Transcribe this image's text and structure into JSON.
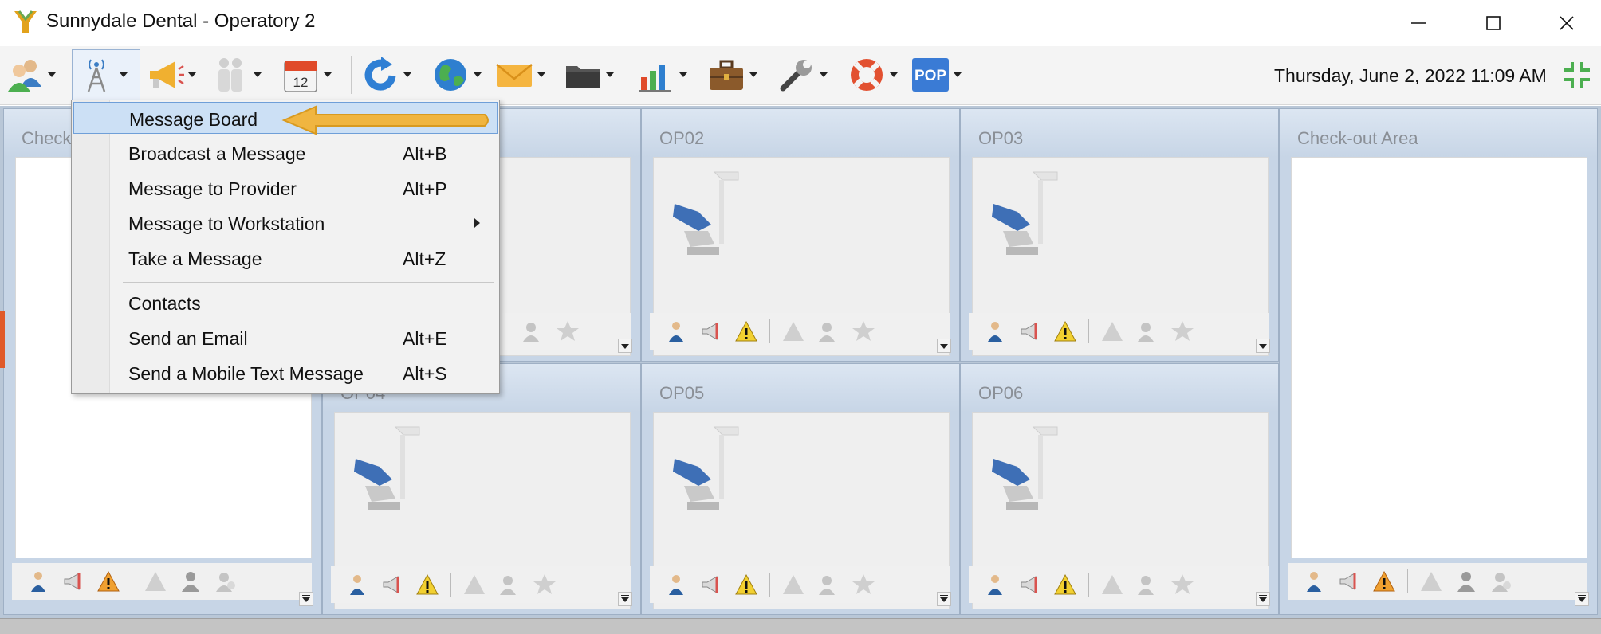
{
  "window": {
    "title": "Sunnydale Dental - Operatory 2",
    "controls": [
      "minimize",
      "maximize",
      "close"
    ]
  },
  "toolbar": {
    "items": [
      {
        "icon": "users-icon"
      },
      {
        "icon": "broadcast-tower-icon",
        "active": true
      },
      {
        "icon": "megaphone-icon"
      },
      {
        "icon": "staff-icon"
      },
      {
        "icon": "calendar-icon",
        "text": "12"
      },
      {
        "icon": "refresh-icon"
      },
      {
        "icon": "globe-icon"
      },
      {
        "icon": "mail-icon"
      },
      {
        "icon": "folder-icon"
      },
      {
        "icon": "bar-chart-icon"
      },
      {
        "icon": "briefcase-icon"
      },
      {
        "icon": "wrench-icon"
      },
      {
        "icon": "lifebuoy-icon"
      },
      {
        "icon": "pop-icon",
        "text": "POP"
      }
    ],
    "datetime": "Thursday, June 2, 2022 11:09 AM",
    "grid_icon": "collapse-grid-icon"
  },
  "menu": {
    "items": [
      {
        "label": "Message Board",
        "shortcut": "",
        "highlighted": true
      },
      {
        "label": "Broadcast a Message",
        "shortcut": "Alt+B"
      },
      {
        "label": "Message to Provider",
        "shortcut": "Alt+P"
      },
      {
        "label": "Message to Workstation",
        "shortcut": "",
        "submenu": true
      },
      {
        "label": "Take a Message",
        "shortcut": "Alt+Z"
      },
      {
        "label": "Contacts",
        "shortcut": ""
      },
      {
        "label": "Send an Email",
        "shortcut": "Alt+E"
      },
      {
        "label": "Send a Mobile Text Message",
        "shortcut": "Alt+S"
      }
    ]
  },
  "panes": {
    "checkin": {
      "title": "Check"
    },
    "op02": {
      "title": "OP02"
    },
    "op03": {
      "title": "OP03"
    },
    "op04": {
      "title": "OP04"
    },
    "op05": {
      "title": "OP05"
    },
    "op06": {
      "title": "OP06"
    },
    "checkout": {
      "title": "Check-out Area"
    }
  },
  "colors": {
    "accent": "#f0a830",
    "selection": "#cce0f5",
    "pane_bg": "#c7d5e6",
    "pop": "#3a7bd5"
  }
}
